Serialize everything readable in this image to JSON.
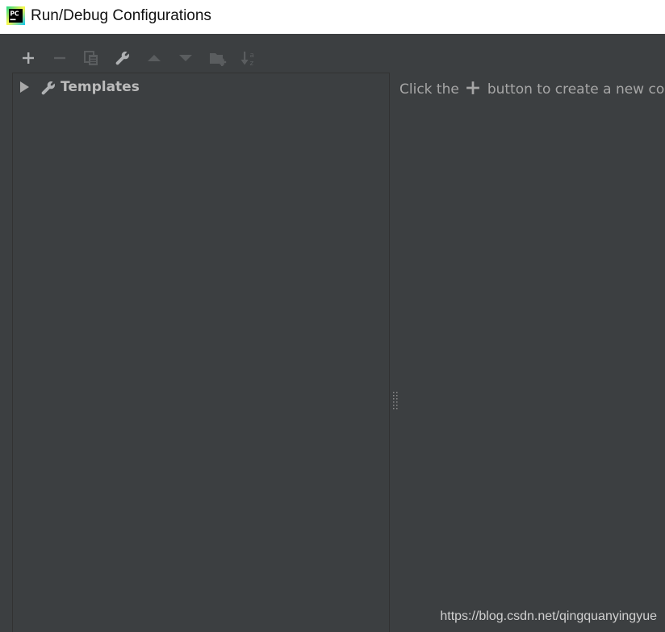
{
  "window": {
    "title": "Run/Debug Configurations",
    "app_icon": "pycharm-icon",
    "app_icon_text": "PC"
  },
  "toolbar": {
    "buttons": [
      {
        "name": "add-icon",
        "enabled": true
      },
      {
        "name": "remove-icon",
        "enabled": false
      },
      {
        "name": "copy-icon",
        "enabled": false
      },
      {
        "name": "wrench-icon",
        "enabled": true
      },
      {
        "name": "move-up-icon",
        "enabled": false
      },
      {
        "name": "move-down-icon",
        "enabled": false
      },
      {
        "name": "new-folder-icon",
        "enabled": false
      },
      {
        "name": "sort-alphabetically-icon",
        "enabled": false
      }
    ]
  },
  "tree": {
    "items": [
      {
        "label": "Templates",
        "icon": "wrench-icon",
        "expanded": false
      }
    ]
  },
  "right_panel": {
    "hint_before": "Click the",
    "hint_icon": "add-icon",
    "hint_after": "button to create a new co"
  },
  "watermark": {
    "text": "https://blog.csdn.net/qingquanyingyue"
  },
  "colors": {
    "background": "#3c3f41",
    "text": "#bbbbbb",
    "enabled_icon": "#afb1b3",
    "disabled_icon": "#5a5d5f"
  }
}
